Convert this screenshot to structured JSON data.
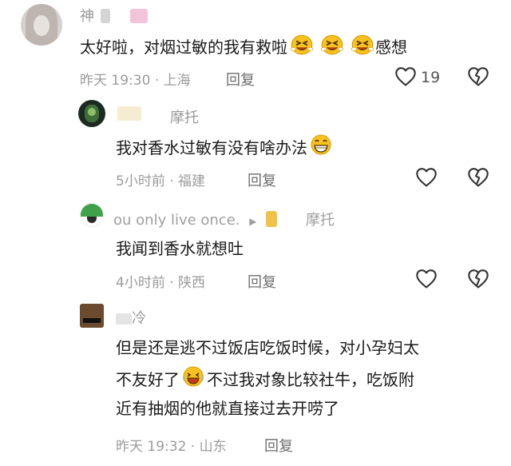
{
  "comments": [
    {
      "user": "神",
      "text": "太好啦，对烟过敏的我有救啦",
      "text_suffix": "感想",
      "time": "昨天 19:30",
      "location": "上海",
      "reply_label": "回复",
      "likes": "19",
      "like_icon": "heart-outline-icon",
      "dislike_icon": "broken-heart-icon"
    },
    {
      "user": "摩托",
      "text": "我对香水过敏有没有啥办法",
      "time": "5小时前",
      "location": "福建",
      "reply_label": "回复"
    },
    {
      "user": "ou only live once.",
      "reply_to": "摩托",
      "text": "我闻到香水就想吐",
      "time": "4小时前",
      "location": "陕西",
      "reply_label": "回复"
    },
    {
      "user": "冷",
      "text_line1": "但是还是逃不过饭店吃饭时候，对小孕妇太",
      "text_line2a": "不友好了",
      "text_line2b": "不过我对象比较社牛，吃饭附",
      "text_line3": "近有抽烟的他就直接过去开唠了",
      "time": "昨天 19:32",
      "location": "山东",
      "reply_label": "回复"
    }
  ],
  "colors": {
    "secondary_text": "#9b9b9b",
    "body_text": "#1a1a1a",
    "icon_stroke": "#333333"
  }
}
